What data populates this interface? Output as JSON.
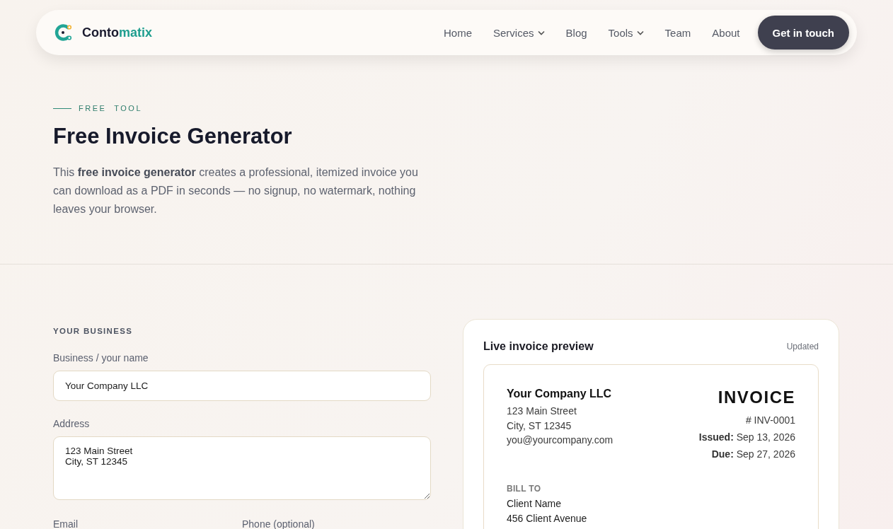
{
  "nav": {
    "brand": {
      "dark": "Conto",
      "accent": "matix"
    },
    "links": [
      {
        "label": "Home",
        "has_menu": false
      },
      {
        "label": "Services",
        "has_menu": true
      },
      {
        "label": "Blog",
        "has_menu": false
      },
      {
        "label": "Tools",
        "has_menu": true
      },
      {
        "label": "Team",
        "has_menu": false
      },
      {
        "label": "About",
        "has_menu": false
      }
    ],
    "cta": "Get in touch"
  },
  "hero": {
    "eyebrow": "FREE  TOOL",
    "title": "Free Invoice Generator",
    "intro": "This **free invoice generator** creates a professional, itemized invoice you can download as a PDF in seconds — no signup, no watermark, nothing leaves your browser."
  },
  "form": {
    "section": "YOUR BUSINESS",
    "fields": [
      {
        "kind": "input",
        "label": "Business / your name",
        "value": "Your Company LLC"
      },
      {
        "kind": "textarea",
        "label": "Address",
        "value": "123 Main Street\nCity, ST 12345"
      }
    ],
    "cut_labels": [
      "Email",
      "Phone (optional)"
    ]
  },
  "preview": {
    "title": "Live invoice preview",
    "status": "Updated",
    "invoice": {
      "company": "Your Company LLC",
      "company_lines": [
        "123 Main Street",
        "City, ST 12345",
        "you@yourcompany.com"
      ],
      "heading": "INVOICE",
      "meta": [
        "# INV-0001",
        "**Issued:** Sep 13, 2026",
        "**Due:** Sep 27, 2026"
      ],
      "bill_to_label": "BILL TO",
      "bill_to_lines": [
        "Client Name",
        "456 Client Avenue"
      ]
    }
  }
}
